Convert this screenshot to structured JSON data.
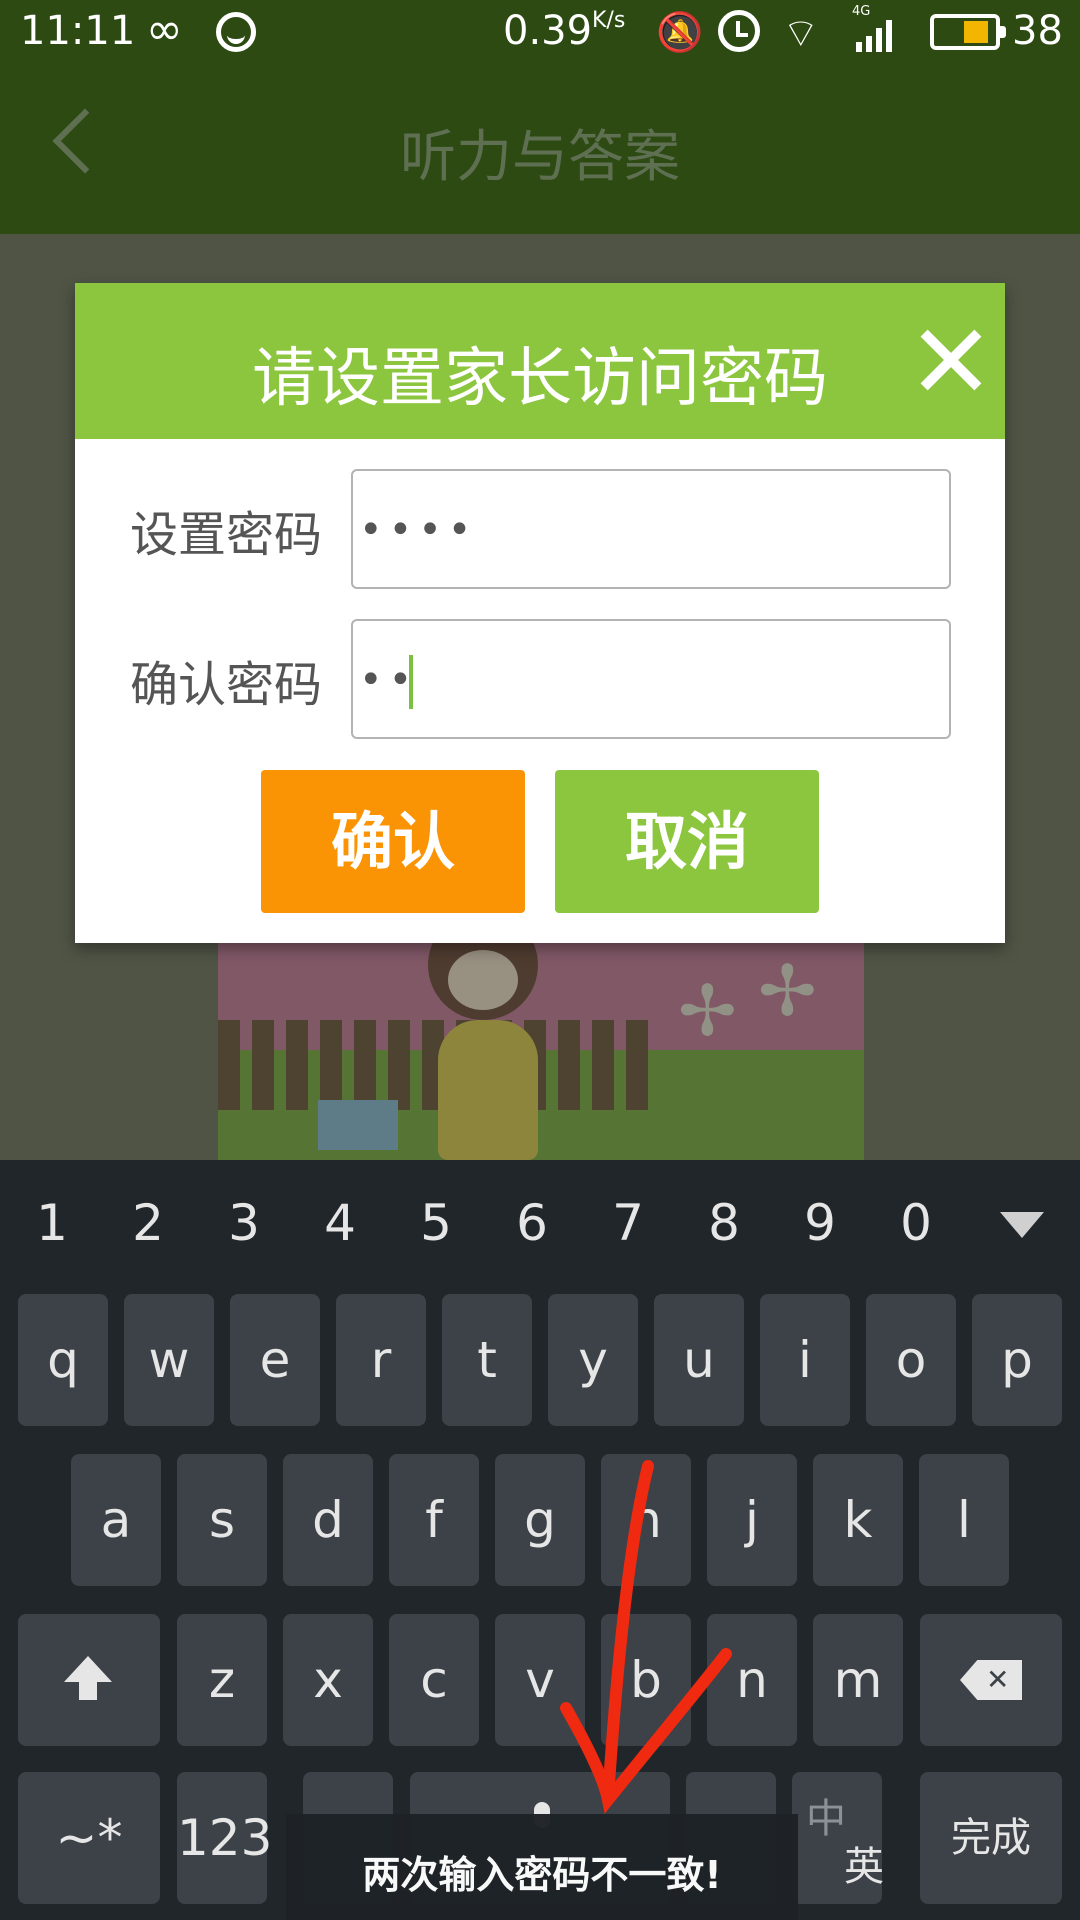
{
  "status_bar": {
    "time": "11:11",
    "speed": "0.39",
    "speed_unit": "K/s",
    "network_type": "4G",
    "battery_level": "38",
    "battery_fraction": 0.38,
    "icons": [
      "infinity-icon",
      "face-icon",
      "mute-bell-icon",
      "alarm-icon",
      "wifi-icon",
      "signal-icon",
      "battery-icon"
    ]
  },
  "app_bar": {
    "back_icon": "chevron-left-icon",
    "title": "听力与答案"
  },
  "dialog": {
    "title": "请设置家长访问密码",
    "close_icon": "close-icon",
    "password_label": "设置密码",
    "password_value": "••••",
    "confirm_password_label": "确认密码",
    "confirm_password_value": "••",
    "confirm_button": "确认",
    "cancel_button": "取消",
    "colors": {
      "header": "#8cc63f",
      "confirm": "#fa9405",
      "cancel": "#8cc63f"
    }
  },
  "keyboard": {
    "collapse_icon": "collapse-keyboard-icon",
    "numbers": [
      "1",
      "2",
      "3",
      "4",
      "5",
      "6",
      "7",
      "8",
      "9",
      "0"
    ],
    "row1": [
      "q",
      "w",
      "e",
      "r",
      "t",
      "y",
      "u",
      "i",
      "o",
      "p"
    ],
    "row2": [
      "a",
      "s",
      "d",
      "f",
      "g",
      "h",
      "j",
      "k",
      "l"
    ],
    "row3": [
      "z",
      "x",
      "c",
      "v",
      "b",
      "n",
      "m"
    ],
    "shift_icon": "shift-icon",
    "backspace_icon": "backspace-icon",
    "symbols_key": "~*",
    "num_key": "123",
    "lang_key_top": "中",
    "lang_key_bottom": "英",
    "done_key": "完成",
    "mic_icon": "mic-icon"
  },
  "toast": {
    "message": "两次输入密码不一致!"
  }
}
